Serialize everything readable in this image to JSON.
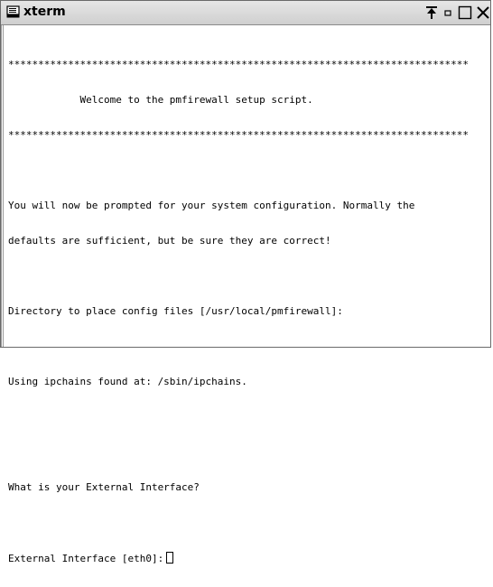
{
  "window": {
    "title": "xterm",
    "icon": "terminal-icon",
    "controls": [
      "pin-icon",
      "minimize-icon",
      "maximize-icon",
      "close-icon"
    ]
  },
  "terminal": {
    "lines": [
      "*****************************************************************************",
      "            Welcome to the pmfirewall setup script.",
      "*****************************************************************************",
      "",
      "You will now be prompted for your system configuration. Normally the",
      "defaults are sufficient, but be sure they are correct!",
      "",
      "Directory to place config files [/usr/local/pmfirewall]:",
      "",
      "Using ipchains found at: /sbin/ipchains.",
      "",
      "",
      "What is your External Interface?",
      "",
      "External Interface [eth0]:"
    ]
  }
}
